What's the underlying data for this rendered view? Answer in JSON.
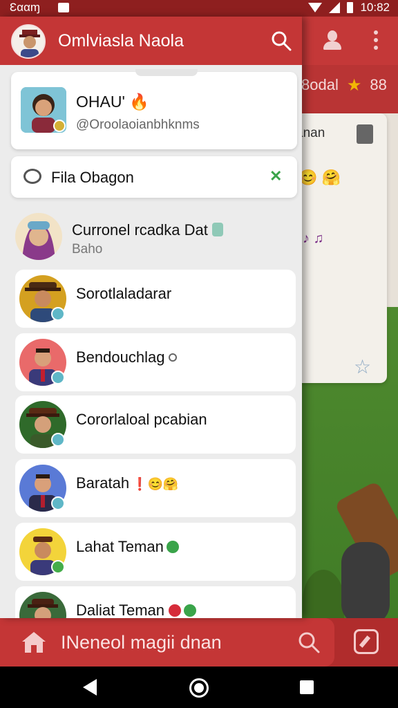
{
  "status_bar": {
    "carrier": "Ɛααɱ",
    "time": "10:82"
  },
  "background_app": {
    "tab_text": "8odal",
    "tab_suffix": "88",
    "card_text": "anan"
  },
  "drawer": {
    "title": "Omlviasla Naola",
    "profile": {
      "name": "OHAU'",
      "handle": "@Oroolaoianbhknms"
    },
    "search": {
      "label": "Fila Obagon"
    },
    "contacts": [
      {
        "name": "Curronel rcadka Dat",
        "subtitle": "Baho"
      },
      {
        "name": "Sorotlaladarar"
      },
      {
        "name": "Bendouchlag"
      },
      {
        "name": "Cororlaloal pcabian"
      },
      {
        "name": "Baratah"
      },
      {
        "name": "Lahat Teman"
      },
      {
        "name": "Daliat Teman"
      }
    ]
  },
  "bottom_bar": {
    "label": "INeneol magii dnan"
  },
  "colors": {
    "primary_red": "#c43636",
    "drawer_bg": "#ececec",
    "badge_blue": "#5fb7c7",
    "badge_green": "#44ad4a"
  }
}
